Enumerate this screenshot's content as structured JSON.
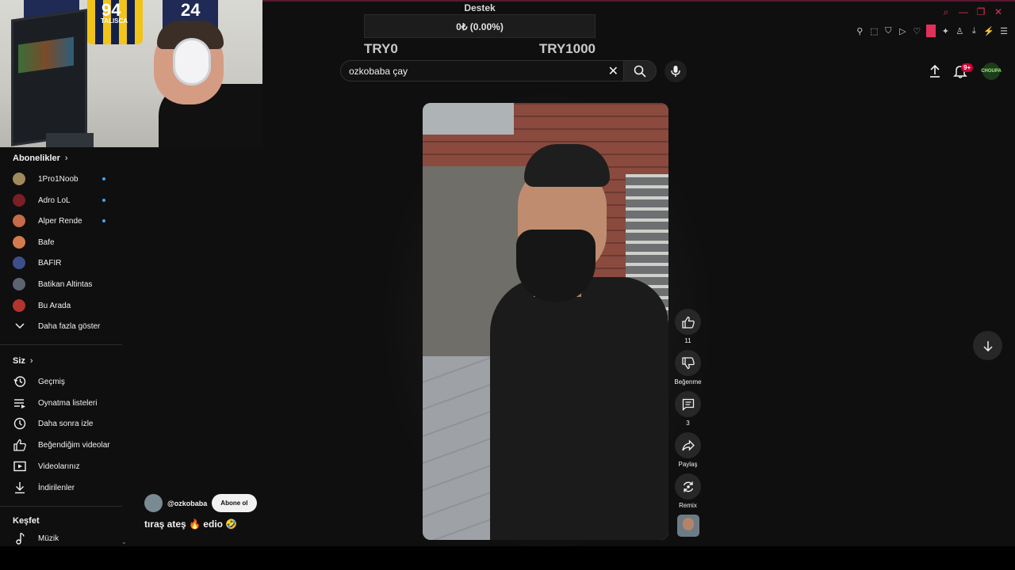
{
  "overlay": {
    "donation_label": "Destek",
    "donation_progress": "0₺ (0.00%)",
    "donation_min": "TRY0",
    "donation_max": "TRY1000",
    "webcam_jerseys": [
      "94",
      "TALISCA",
      "24"
    ]
  },
  "topbar": {
    "search_value": "ozkobaba çay",
    "notification_badge": "9+",
    "avatar_text": "CHOUPA"
  },
  "sidebar": {
    "subscriptions_title": "Abonelikler",
    "channels": [
      {
        "label": "1Pro1Noob",
        "avatar_color": "#a08a5c",
        "new": true
      },
      {
        "label": "Adro LoL",
        "avatar_color": "#7a1f24",
        "new": true
      },
      {
        "label": "Alper Rende",
        "avatar_color": "#c56b4a",
        "new": true
      },
      {
        "label": "Bafe",
        "avatar_color": "#d27c4e",
        "new": false
      },
      {
        "label": "BAFIR",
        "avatar_color": "#3c4f8a",
        "new": false
      },
      {
        "label": "Batikan Altintas",
        "avatar_color": "#5b6470",
        "new": false
      },
      {
        "label": "Bu Arada",
        "avatar_color": "#b3342e",
        "new": false
      }
    ],
    "show_more": "Daha fazla göster",
    "you_title": "Siz",
    "you_items": [
      {
        "label": "Geçmiş",
        "icon": "history-icon"
      },
      {
        "label": "Oynatma listeleri",
        "icon": "playlist-icon"
      },
      {
        "label": "Daha sonra izle",
        "icon": "watch-later-icon"
      },
      {
        "label": "Beğendiğim videolar",
        "icon": "liked-icon"
      },
      {
        "label": "Videolarınız",
        "icon": "your-videos-icon"
      },
      {
        "label": "İndirilenler",
        "icon": "download-icon"
      }
    ],
    "explore_title": "Keşfet",
    "explore_items": [
      {
        "label": "Müzik",
        "icon": "music-icon"
      }
    ]
  },
  "short": {
    "channel_handle": "@ozkobaba",
    "subscribe_label": "Abone ol",
    "title": "tıraş ateş 🔥 edio 🤣",
    "like_count": "11",
    "dislike_label": "Beğenme",
    "comment_count": "3",
    "share_label": "Paylaş",
    "remix_label": "Remix"
  },
  "colors": {
    "accent": "#e0315b",
    "background": "#0f0f0f",
    "new_dot": "#3ea6ff",
    "badge": "#cc0033"
  }
}
